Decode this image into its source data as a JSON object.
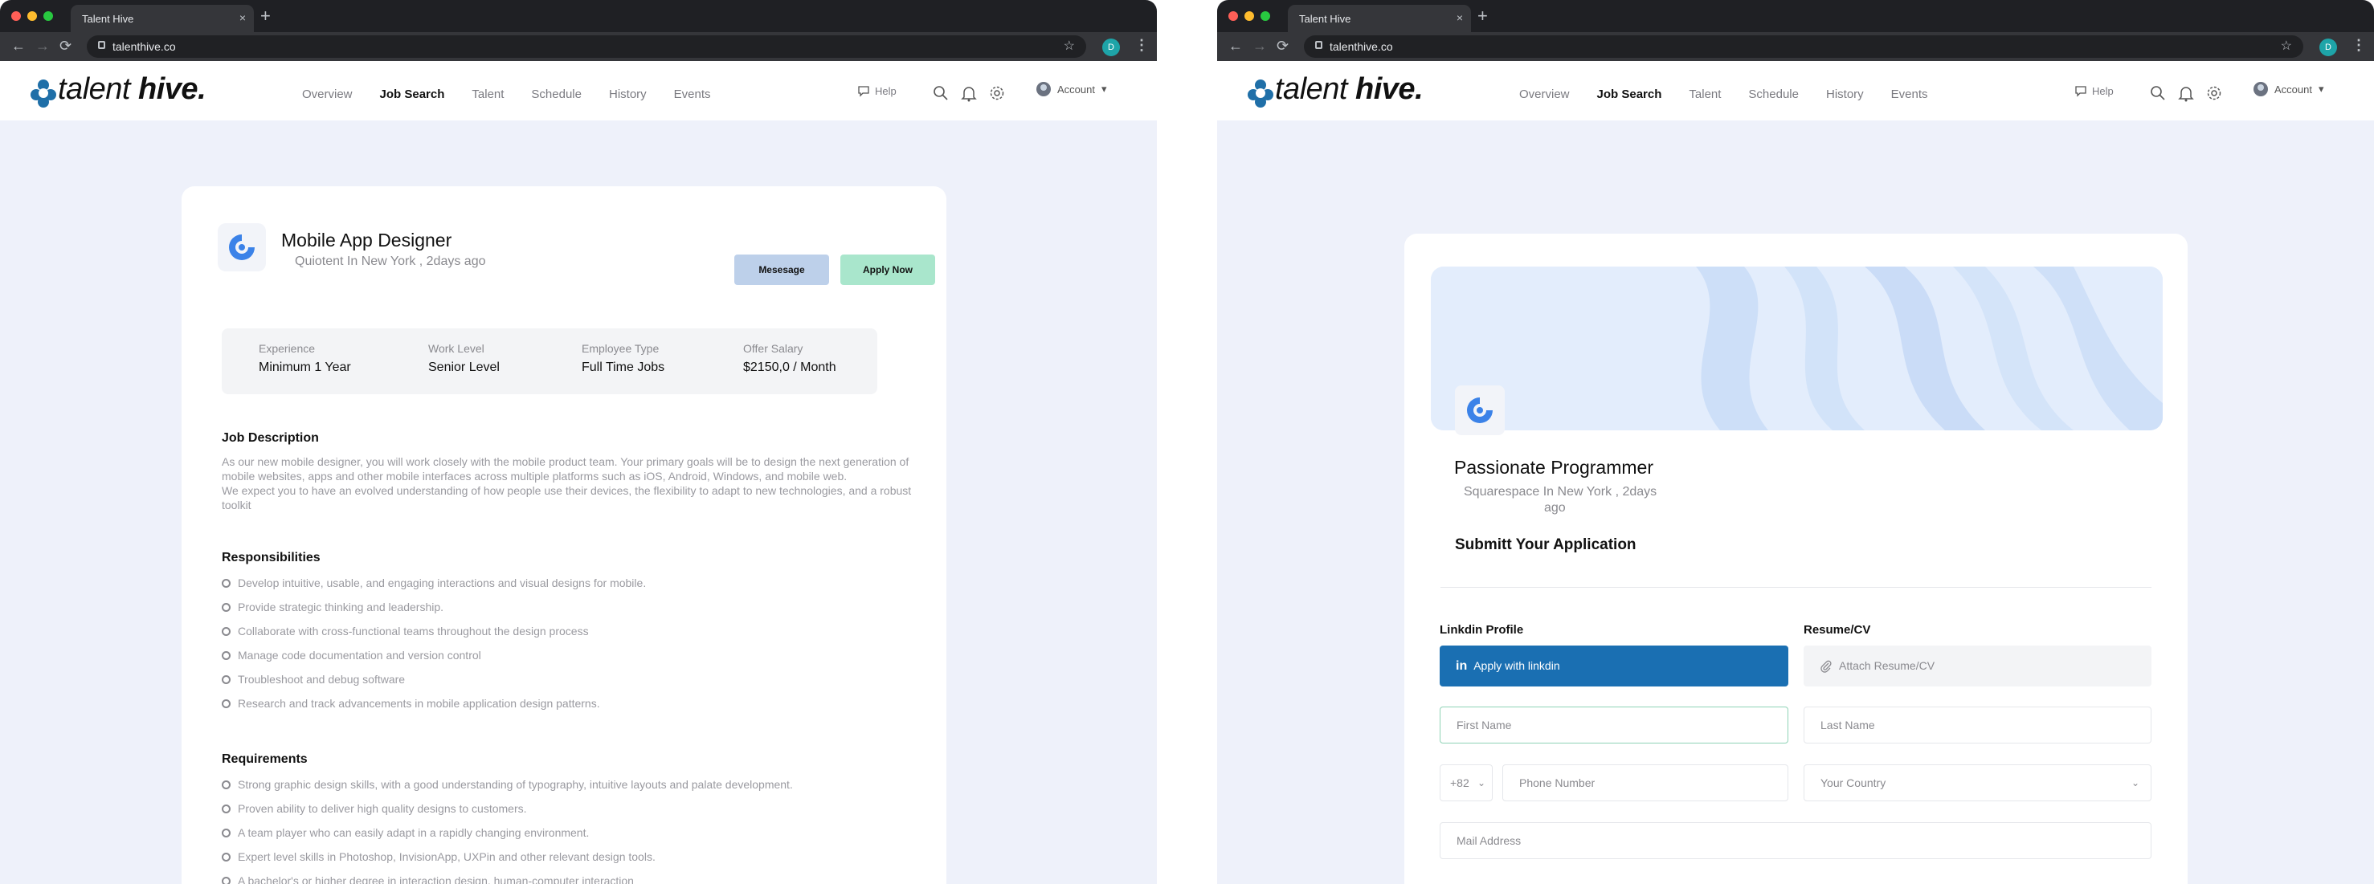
{
  "browser": {
    "tab_title": "Talent Hive",
    "tab_close": "×",
    "new_tab": "+",
    "url": "talenthive.co",
    "profile_initial": "D",
    "star": "☆",
    "menu": "⋮",
    "back": "←",
    "forward": "→",
    "reload": "⟳"
  },
  "header": {
    "brand_part1": "talent ",
    "brand_part2": "hive.",
    "nav": [
      "Overview",
      "Job Search",
      "Talent",
      "Schedule",
      "History",
      "Events"
    ],
    "active_nav": "Job Search",
    "help": "Help",
    "account": "Account",
    "account_caret": "▾"
  },
  "left": {
    "job_title": "Mobile App Designer",
    "job_sub": "Quiotent In New York , 2days ago",
    "message_btn": "Mesesage",
    "apply_btn": "Apply Now",
    "stats": [
      {
        "label": "Experience",
        "value": "Minimum 1 Year"
      },
      {
        "label": "Work Level",
        "value": "Senior Level"
      },
      {
        "label": "Employee Type",
        "value": "Full Time Jobs"
      },
      {
        "label": "Offer Salary",
        "value": "$2150,0 / Month"
      }
    ],
    "desc_heading": "Job Description",
    "desc_lines": [
      "As our new mobile designer, you will work closely with the mobile product team. Your primary goals will be to design the next generation of",
      "mobile websites, apps and other mobile interfaces across multiple platforms such as iOS, Android, Windows, and mobile web.",
      "We expect you to have an evolved understanding of how people use their devices, the flexibility to adapt to new technologies, and a robust",
      "toolkit"
    ],
    "resp_heading": "Responsibilities",
    "responsibilities": [
      "Develop intuitive, usable, and engaging interactions and visual designs for mobile.",
      "Provide strategic thinking and leadership.",
      "Collaborate with cross-functional teams throughout the design process",
      "Manage code documentation and version control",
      "Troubleshoot and debug software",
      "Research and track advancements in mobile application design patterns."
    ],
    "req_heading": "Requirements",
    "requirements": [
      "Strong graphic design skills, with a good understanding of typography, intuitive layouts and palate development.",
      "Proven ability to deliver high quality designs to customers.",
      "A team player who can easily adapt in a rapidly changing environment.",
      "Expert level skills in Photoshop, InvisionApp, UXPin and other relevant design tools.",
      "A bachelor's or higher degree in interaction design, human-computer interaction"
    ]
  },
  "right": {
    "job_title": "Passionate Programmer",
    "job_sub_line1": "Squarespace In New York , 2days",
    "job_sub_line2": "ago",
    "submit_heading": "Submitt Your Application",
    "linkedin_label": "Linkdin Profile",
    "resume_label": "Resume/CV",
    "linkedin_btn_icon": "in",
    "linkedin_btn": "Apply with linkdin",
    "attach_placeholder": "Attach Resume/CV",
    "first_name_placeholder": "First Name",
    "last_name_placeholder": "Last Name",
    "country_code": "+82",
    "phone_placeholder": "Phone Number",
    "country_placeholder": "Your Country",
    "mail_placeholder": "Mail Address",
    "chevron": "⌄"
  },
  "colors": {
    "primary_linkedin": "#1a6fb2",
    "apply_green": "#a9e6cc",
    "message_blue": "#bdd0ea",
    "page_bg": "#eef1fa"
  }
}
